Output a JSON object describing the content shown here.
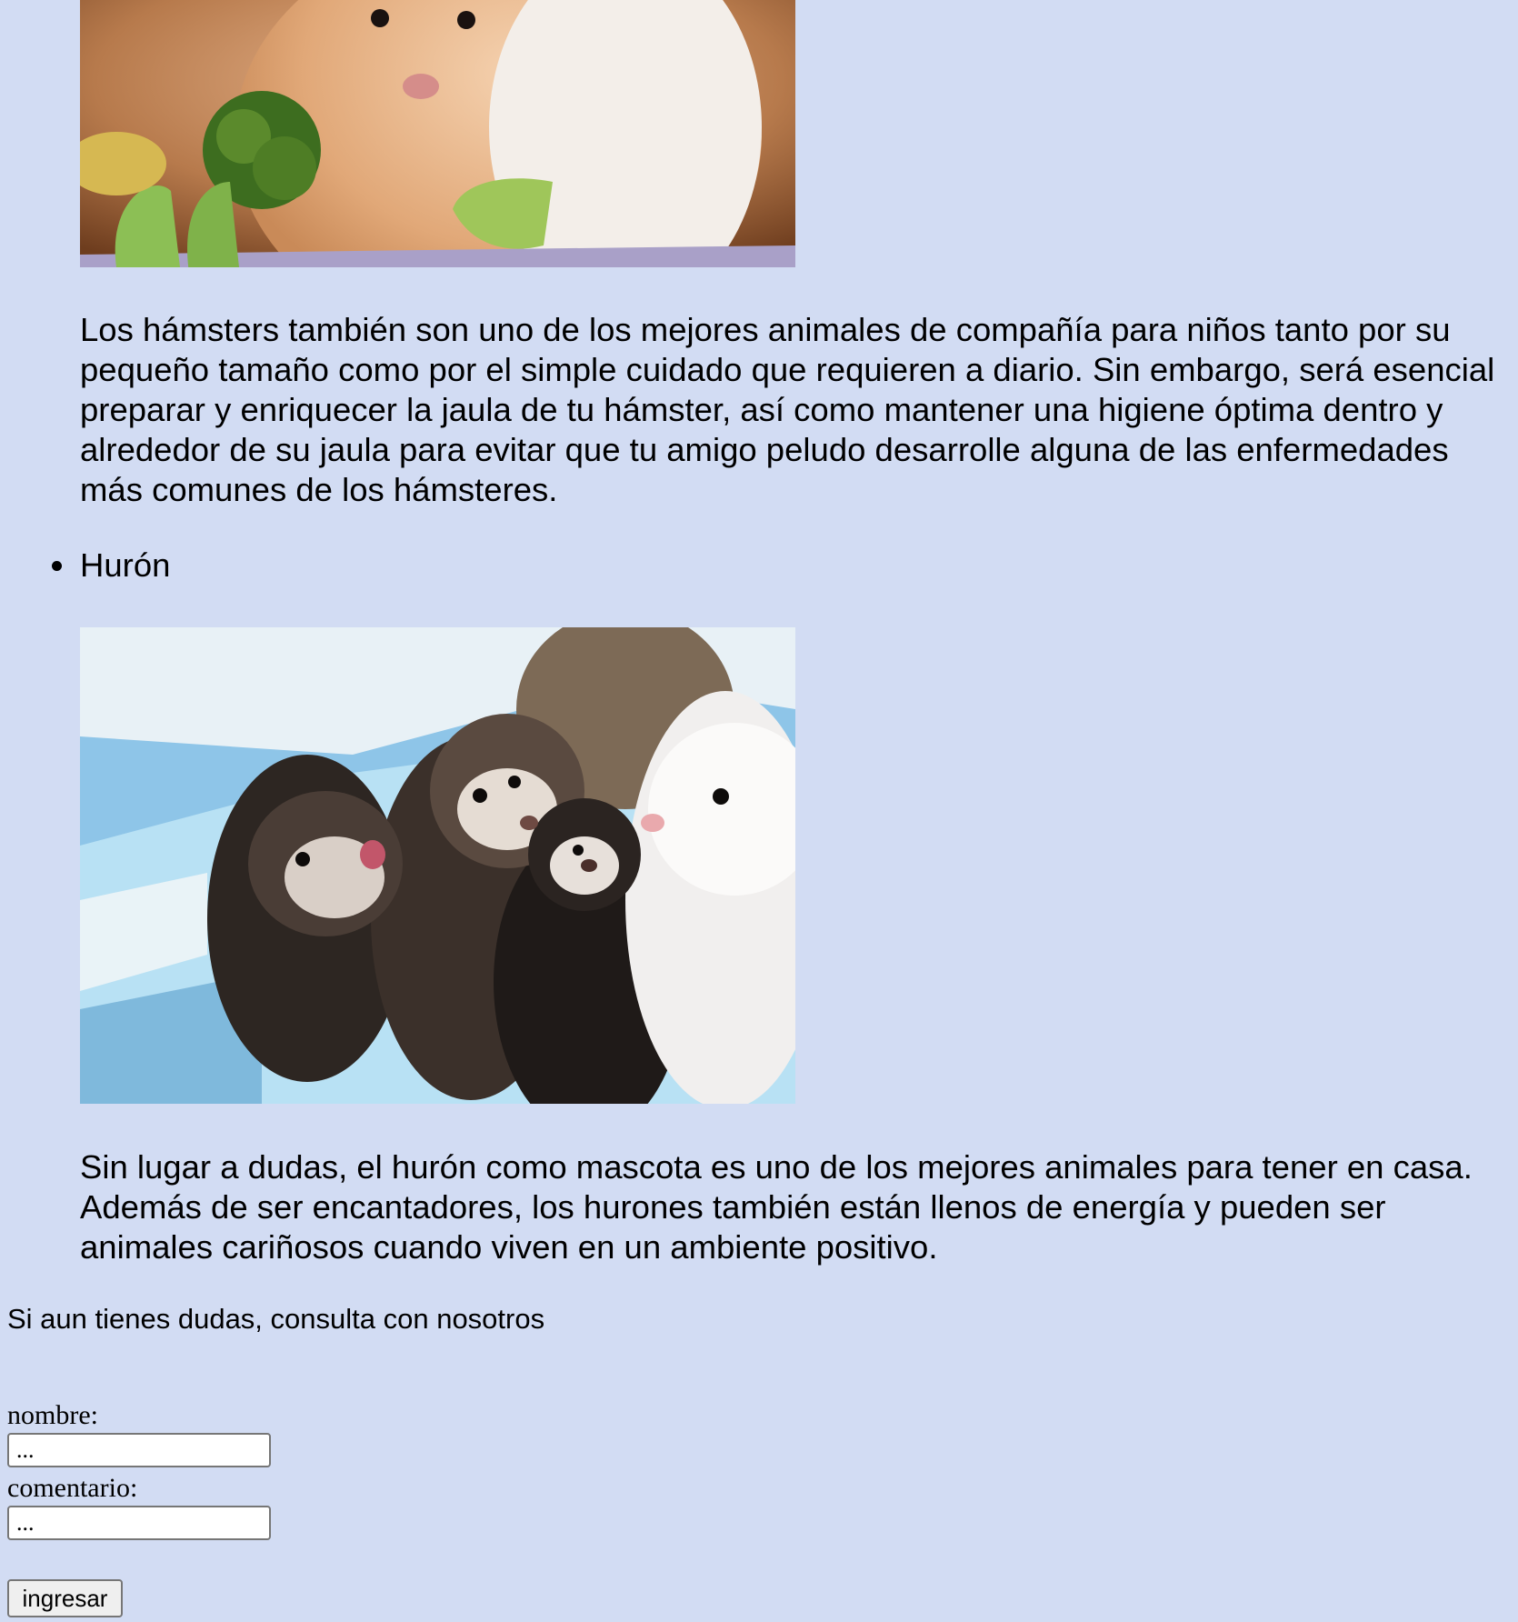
{
  "sections": {
    "hamster": {
      "image_alt": "hamster-photo",
      "description": "Los hámsters también son uno de los mejores animales de compañía para niños tanto por su pequeño tamaño como por el simple cuidado que requieren a diario. Sin embargo, será esencial preparar y enriquecer la jaula de tu hámster, así como mantener una higiene óptima dentro y alrededor de su jaula para evitar que tu amigo peludo desarrolle alguna de las enfermedades más comunes de los hámsteres."
    },
    "ferret": {
      "title": "Hurón",
      "image_alt": "ferret-photo",
      "description": "Sin lugar a dudas, el hurón como mascota es uno de los mejores animales para tener en casa. Además de ser encantadores, los hurones también están llenos de energía y pueden ser animales cariñosos cuando viven en un ambiente positivo."
    }
  },
  "contact": {
    "prompt": "Si aun tienes dudas, consulta con nosotros",
    "name_label": "nombre:",
    "name_value": "...",
    "comment_label": "comentario:",
    "comment_value": "...",
    "submit_label": "ingresar"
  },
  "colors": {
    "background": "#d2dcf3"
  }
}
